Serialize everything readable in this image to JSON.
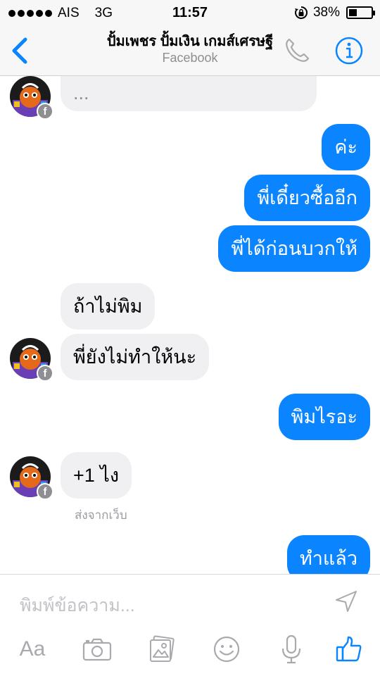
{
  "status_bar": {
    "carrier": "AIS",
    "network": "3G",
    "time": "11:57",
    "battery_percent": "38%",
    "battery_level": 0.38
  },
  "nav": {
    "title": "ปั้มเพชร ปั้มเงิน เกมส์เศรษฐี",
    "subtitle": "Facebook",
    "back_icon": "chevron-left-icon",
    "call_icon": "phone-icon",
    "info_icon": "info-icon"
  },
  "conversation": {
    "truncated_incoming": "...",
    "messages": [
      {
        "direction": "outgoing",
        "text": "ค่ะ"
      },
      {
        "direction": "outgoing",
        "text": "พี่เดี๋ยวซื้ออีก"
      },
      {
        "direction": "outgoing",
        "text": "พี่ได้ก่อนบวกให้"
      },
      {
        "direction": "incoming",
        "text": "ถ้าไม่พิม"
      },
      {
        "direction": "incoming",
        "text": "พี่ยังไม่ทำให้นะ"
      },
      {
        "direction": "outgoing",
        "text": "พิมไรอะ"
      },
      {
        "direction": "incoming",
        "text": "+1 ไง"
      },
      {
        "direction": "outgoing",
        "text": "ทำแล้ว"
      }
    ],
    "sent_via": "ส่งจากเว็บ",
    "badge_letter": "f"
  },
  "composer": {
    "placeholder": "พิมพ์ข้อความ...",
    "toolbar": {
      "text_label": "Aa",
      "icons": [
        "camera-icon",
        "photo-icon",
        "emoji-icon",
        "microphone-icon",
        "thumbs-up-icon"
      ]
    }
  },
  "colors": {
    "accent": "#0a84ff",
    "incoming_bubble": "#f0f0f2",
    "secondary_text": "#8e8e93"
  }
}
